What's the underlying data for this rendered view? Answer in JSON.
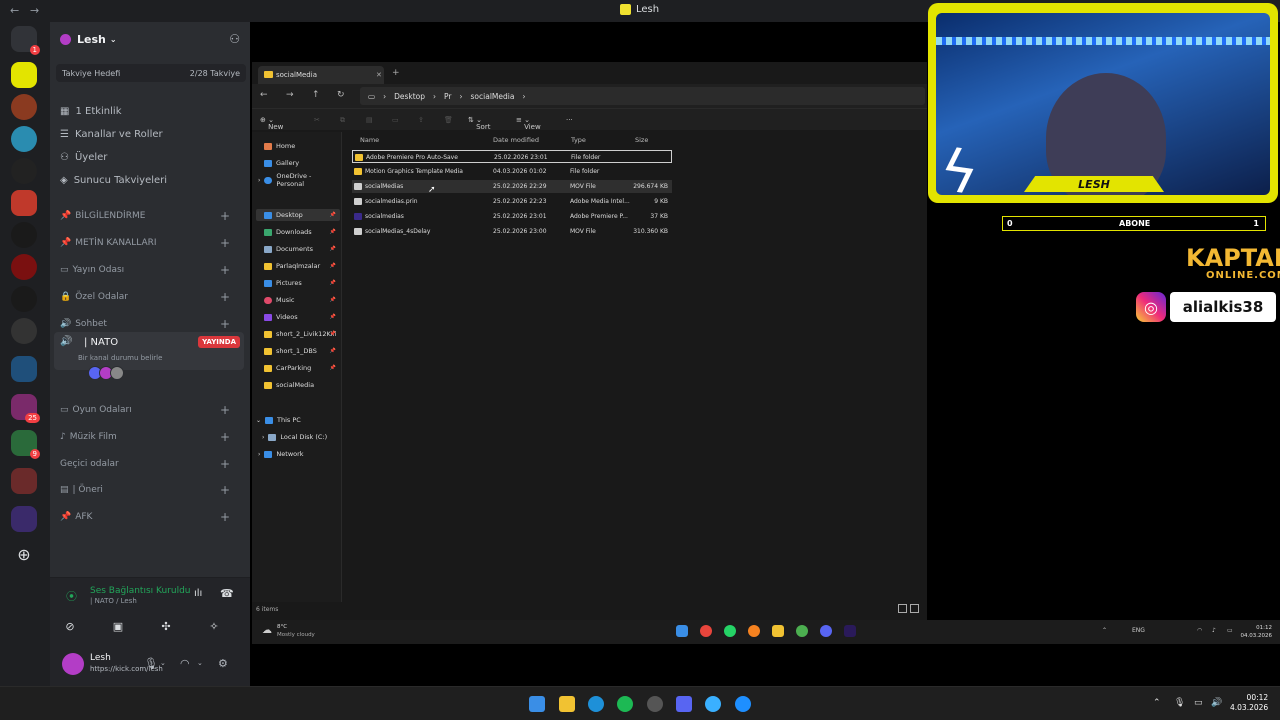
{
  "window": {
    "title": "Lesh"
  },
  "rail": {
    "notification_badge": "1",
    "badge_25": "25",
    "badge_9": "9"
  },
  "guild": {
    "name": "Lesh",
    "boost_label": "Takviye Hedefi",
    "boost_count": "2/28 Takviye",
    "nav": [
      "1 Etkinlik",
      "Kanallar ve Roller",
      "Üyeler",
      "Sunucu Takviyeleri"
    ],
    "categories": [
      "BİLGİLENDİRME",
      "METİN KANALLARI",
      "Yayın Odası",
      "Özel Odalar",
      "Sohbet"
    ],
    "voice_channel": {
      "name": "| NATO",
      "subtitle": "Bir kanal durumu belirle",
      "live": "YAYINDA"
    },
    "categories2": [
      "Oyun Odaları",
      "Müzik Film",
      "Geçici odalar",
      "| Öneri",
      "AFK"
    ]
  },
  "voice_panel": {
    "title": "Ses Bağlantısı Kuruldu",
    "subtitle": "| NATO / Lesh"
  },
  "user": {
    "name": "Lesh",
    "status": "https://kick.com/lesh"
  },
  "explorer": {
    "tab": "socialMedia",
    "crumbs": [
      "Desktop",
      "Pr",
      "socialMedia"
    ],
    "toolbar": {
      "new": "New",
      "sort": "Sort",
      "view": "View"
    },
    "columns": [
      "Name",
      "Date modified",
      "Type",
      "Size"
    ],
    "nav": [
      "Home",
      "Gallery",
      "OneDrive - Personal",
      "Desktop",
      "Downloads",
      "Documents",
      "Parlaqlmzalar",
      "Pictures",
      "Music",
      "Videos",
      "short_2_Livik12Kill",
      "short_1_DBS",
      "CarParking",
      "socialMedia",
      "This PC",
      "Local Disk (C:)",
      "Network"
    ],
    "files": [
      {
        "name": "Adobe Premiere Pro Auto-Save",
        "date": "25.02.2026 23:01",
        "type": "File folder",
        "size": ""
      },
      {
        "name": "Motion Graphics Template Media",
        "date": "04.03.2026 01:02",
        "type": "File folder",
        "size": ""
      },
      {
        "name": "socialMedias",
        "date": "25.02.2026 22:29",
        "type": "MOV File",
        "size": "296.674 KB"
      },
      {
        "name": "socialmedias.prin",
        "date": "25.02.2026 22:23",
        "type": "Adobe Media Intel...",
        "size": "9 KB"
      },
      {
        "name": "socialmedias",
        "date": "25.02.2026 23:01",
        "type": "Adobe Premiere P...",
        "size": "37 KB"
      },
      {
        "name": "socialMedias_4sDelay",
        "date": "25.02.2026 23:00",
        "type": "MOV File",
        "size": "310.360 KB"
      }
    ],
    "status": "6 items",
    "weather_temp": "8°C",
    "weather_desc": "Mostly cloudy",
    "tray_lang": "ENG",
    "clock_time": "01:12",
    "clock_date": "04.03.2026"
  },
  "stream": {
    "cam_name": "LESH",
    "sub_left": "0",
    "sub_label": "ABONE",
    "sub_right": "1",
    "kaptan": "KAPTAN",
    "online": "ONLINE.COM",
    "instagram": "alialkis38"
  },
  "taskbar": {
    "time": "00:12",
    "date": "4.03.2026"
  }
}
